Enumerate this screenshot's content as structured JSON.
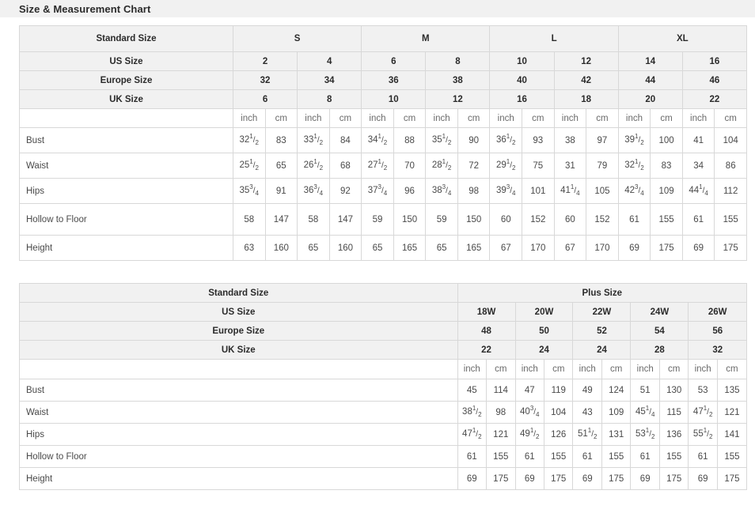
{
  "header": {
    "title": "Size & Measurement Chart"
  },
  "standard_chart": {
    "corner_label": "Standard Size",
    "groups": [
      {
        "label": "S",
        "span": 4
      },
      {
        "label": "M",
        "span": 4
      },
      {
        "label": "L",
        "span": 4
      },
      {
        "label": "XL",
        "span": 4
      }
    ],
    "size_rows": [
      {
        "label": "US Size",
        "values": [
          "2",
          "4",
          "6",
          "8",
          "10",
          "12",
          "14",
          "16"
        ]
      },
      {
        "label": "Europe Size",
        "values": [
          "32",
          "34",
          "36",
          "38",
          "40",
          "42",
          "44",
          "46"
        ]
      },
      {
        "label": "UK Size",
        "values": [
          "6",
          "8",
          "10",
          "12",
          "16",
          "18",
          "20",
          "22"
        ]
      }
    ],
    "unit_row": {
      "label": "",
      "units": [
        "inch",
        "cm",
        "inch",
        "cm",
        "inch",
        "cm",
        "inch",
        "cm",
        "inch",
        "cm",
        "inch",
        "cm",
        "inch",
        "cm",
        "inch",
        "cm"
      ]
    },
    "measure_rows": [
      {
        "label": "Bust",
        "tall": false,
        "cells": [
          {
            "whole": "32",
            "num": "1",
            "den": "2"
          },
          {
            "whole": "83"
          },
          {
            "whole": "33",
            "num": "1",
            "den": "2"
          },
          {
            "whole": "84"
          },
          {
            "whole": "34",
            "num": "1",
            "den": "2"
          },
          {
            "whole": "88"
          },
          {
            "whole": "35",
            "num": "1",
            "den": "2"
          },
          {
            "whole": "90"
          },
          {
            "whole": "36",
            "num": "1",
            "den": "2"
          },
          {
            "whole": "93"
          },
          {
            "whole": "38"
          },
          {
            "whole": "97"
          },
          {
            "whole": "39",
            "num": "1",
            "den": "2"
          },
          {
            "whole": "100"
          },
          {
            "whole": "41"
          },
          {
            "whole": "104"
          }
        ]
      },
      {
        "label": "Waist",
        "tall": false,
        "cells": [
          {
            "whole": "25",
            "num": "1",
            "den": "2"
          },
          {
            "whole": "65"
          },
          {
            "whole": "26",
            "num": "1",
            "den": "2"
          },
          {
            "whole": "68"
          },
          {
            "whole": "27",
            "num": "1",
            "den": "2"
          },
          {
            "whole": "70"
          },
          {
            "whole": "28",
            "num": "1",
            "den": "2"
          },
          {
            "whole": "72"
          },
          {
            "whole": "29",
            "num": "1",
            "den": "2"
          },
          {
            "whole": "75"
          },
          {
            "whole": "31"
          },
          {
            "whole": "79"
          },
          {
            "whole": "32",
            "num": "1",
            "den": "2"
          },
          {
            "whole": "83"
          },
          {
            "whole": "34"
          },
          {
            "whole": "86"
          }
        ]
      },
      {
        "label": "Hips",
        "tall": false,
        "cells": [
          {
            "whole": "35",
            "num": "3",
            "den": "4"
          },
          {
            "whole": "91"
          },
          {
            "whole": "36",
            "num": "3",
            "den": "4"
          },
          {
            "whole": "92"
          },
          {
            "whole": "37",
            "num": "3",
            "den": "4"
          },
          {
            "whole": "96"
          },
          {
            "whole": "38",
            "num": "3",
            "den": "4"
          },
          {
            "whole": "98"
          },
          {
            "whole": "39",
            "num": "3",
            "den": "4"
          },
          {
            "whole": "101"
          },
          {
            "whole": "41",
            "num": "1",
            "den": "4"
          },
          {
            "whole": "105"
          },
          {
            "whole": "42",
            "num": "3",
            "den": "4"
          },
          {
            "whole": "109"
          },
          {
            "whole": "44",
            "num": "1",
            "den": "4"
          },
          {
            "whole": "112"
          }
        ]
      },
      {
        "label": "Hollow to Floor",
        "tall": true,
        "cells": [
          {
            "whole": "58"
          },
          {
            "whole": "147"
          },
          {
            "whole": "58"
          },
          {
            "whole": "147"
          },
          {
            "whole": "59"
          },
          {
            "whole": "150"
          },
          {
            "whole": "59"
          },
          {
            "whole": "150"
          },
          {
            "whole": "60"
          },
          {
            "whole": "152"
          },
          {
            "whole": "60"
          },
          {
            "whole": "152"
          },
          {
            "whole": "61"
          },
          {
            "whole": "155"
          },
          {
            "whole": "61"
          },
          {
            "whole": "155"
          }
        ]
      },
      {
        "label": "Height",
        "tall": false,
        "cells": [
          {
            "whole": "63"
          },
          {
            "whole": "160"
          },
          {
            "whole": "65"
          },
          {
            "whole": "160"
          },
          {
            "whole": "65"
          },
          {
            "whole": "165"
          },
          {
            "whole": "65"
          },
          {
            "whole": "165"
          },
          {
            "whole": "67"
          },
          {
            "whole": "170"
          },
          {
            "whole": "67"
          },
          {
            "whole": "170"
          },
          {
            "whole": "69"
          },
          {
            "whole": "175"
          },
          {
            "whole": "69"
          },
          {
            "whole": "175"
          }
        ]
      }
    ]
  },
  "plus_chart": {
    "corner_label": "Standard Size",
    "groups": [
      {
        "label": "Plus Size",
        "span": 10
      }
    ],
    "size_rows": [
      {
        "label": "US Size",
        "values": [
          "18W",
          "20W",
          "22W",
          "24W",
          "26W"
        ]
      },
      {
        "label": "Europe Size",
        "values": [
          "48",
          "50",
          "52",
          "54",
          "56"
        ]
      },
      {
        "label": "UK Size",
        "values": [
          "22",
          "24",
          "24",
          "28",
          "32"
        ]
      }
    ],
    "unit_row": {
      "label": "",
      "units": [
        "inch",
        "cm",
        "inch",
        "cm",
        "inch",
        "cm",
        "inch",
        "cm",
        "inch",
        "cm"
      ]
    },
    "measure_rows": [
      {
        "label": "Bust",
        "cells": [
          {
            "whole": "45"
          },
          {
            "whole": "114"
          },
          {
            "whole": "47"
          },
          {
            "whole": "119"
          },
          {
            "whole": "49"
          },
          {
            "whole": "124"
          },
          {
            "whole": "51"
          },
          {
            "whole": "130"
          },
          {
            "whole": "53"
          },
          {
            "whole": "135"
          }
        ]
      },
      {
        "label": "Waist",
        "cells": [
          {
            "whole": "38",
            "num": "1",
            "den": "2"
          },
          {
            "whole": "98"
          },
          {
            "whole": "40",
            "num": "3",
            "den": "4"
          },
          {
            "whole": "104"
          },
          {
            "whole": "43"
          },
          {
            "whole": "109"
          },
          {
            "whole": "45",
            "num": "1",
            "den": "4"
          },
          {
            "whole": "115"
          },
          {
            "whole": "47",
            "num": "1",
            "den": "2"
          },
          {
            "whole": "121"
          }
        ]
      },
      {
        "label": "Hips",
        "cells": [
          {
            "whole": "47",
            "num": "1",
            "den": "2"
          },
          {
            "whole": "121"
          },
          {
            "whole": "49",
            "num": "1",
            "den": "2"
          },
          {
            "whole": "126"
          },
          {
            "whole": "51",
            "num": "1",
            "den": "2"
          },
          {
            "whole": "131"
          },
          {
            "whole": "53",
            "num": "1",
            "den": "2"
          },
          {
            "whole": "136"
          },
          {
            "whole": "55",
            "num": "1",
            "den": "2"
          },
          {
            "whole": "141"
          }
        ]
      },
      {
        "label": "Hollow to Floor",
        "cells": [
          {
            "whole": "61"
          },
          {
            "whole": "155"
          },
          {
            "whole": "61"
          },
          {
            "whole": "155"
          },
          {
            "whole": "61"
          },
          {
            "whole": "155"
          },
          {
            "whole": "61"
          },
          {
            "whole": "155"
          },
          {
            "whole": "61"
          },
          {
            "whole": "155"
          }
        ]
      },
      {
        "label": "Height",
        "cells": [
          {
            "whole": "69"
          },
          {
            "whole": "175"
          },
          {
            "whole": "69"
          },
          {
            "whole": "175"
          },
          {
            "whole": "69"
          },
          {
            "whole": "175"
          },
          {
            "whole": "69"
          },
          {
            "whole": "175"
          },
          {
            "whole": "69"
          },
          {
            "whole": "175"
          }
        ]
      }
    ]
  },
  "colors": {
    "header_bg": "#f1f1f1",
    "border": "#d8d8d8",
    "text": "#4a4a4a",
    "heading_text": "#2b2b2b"
  }
}
